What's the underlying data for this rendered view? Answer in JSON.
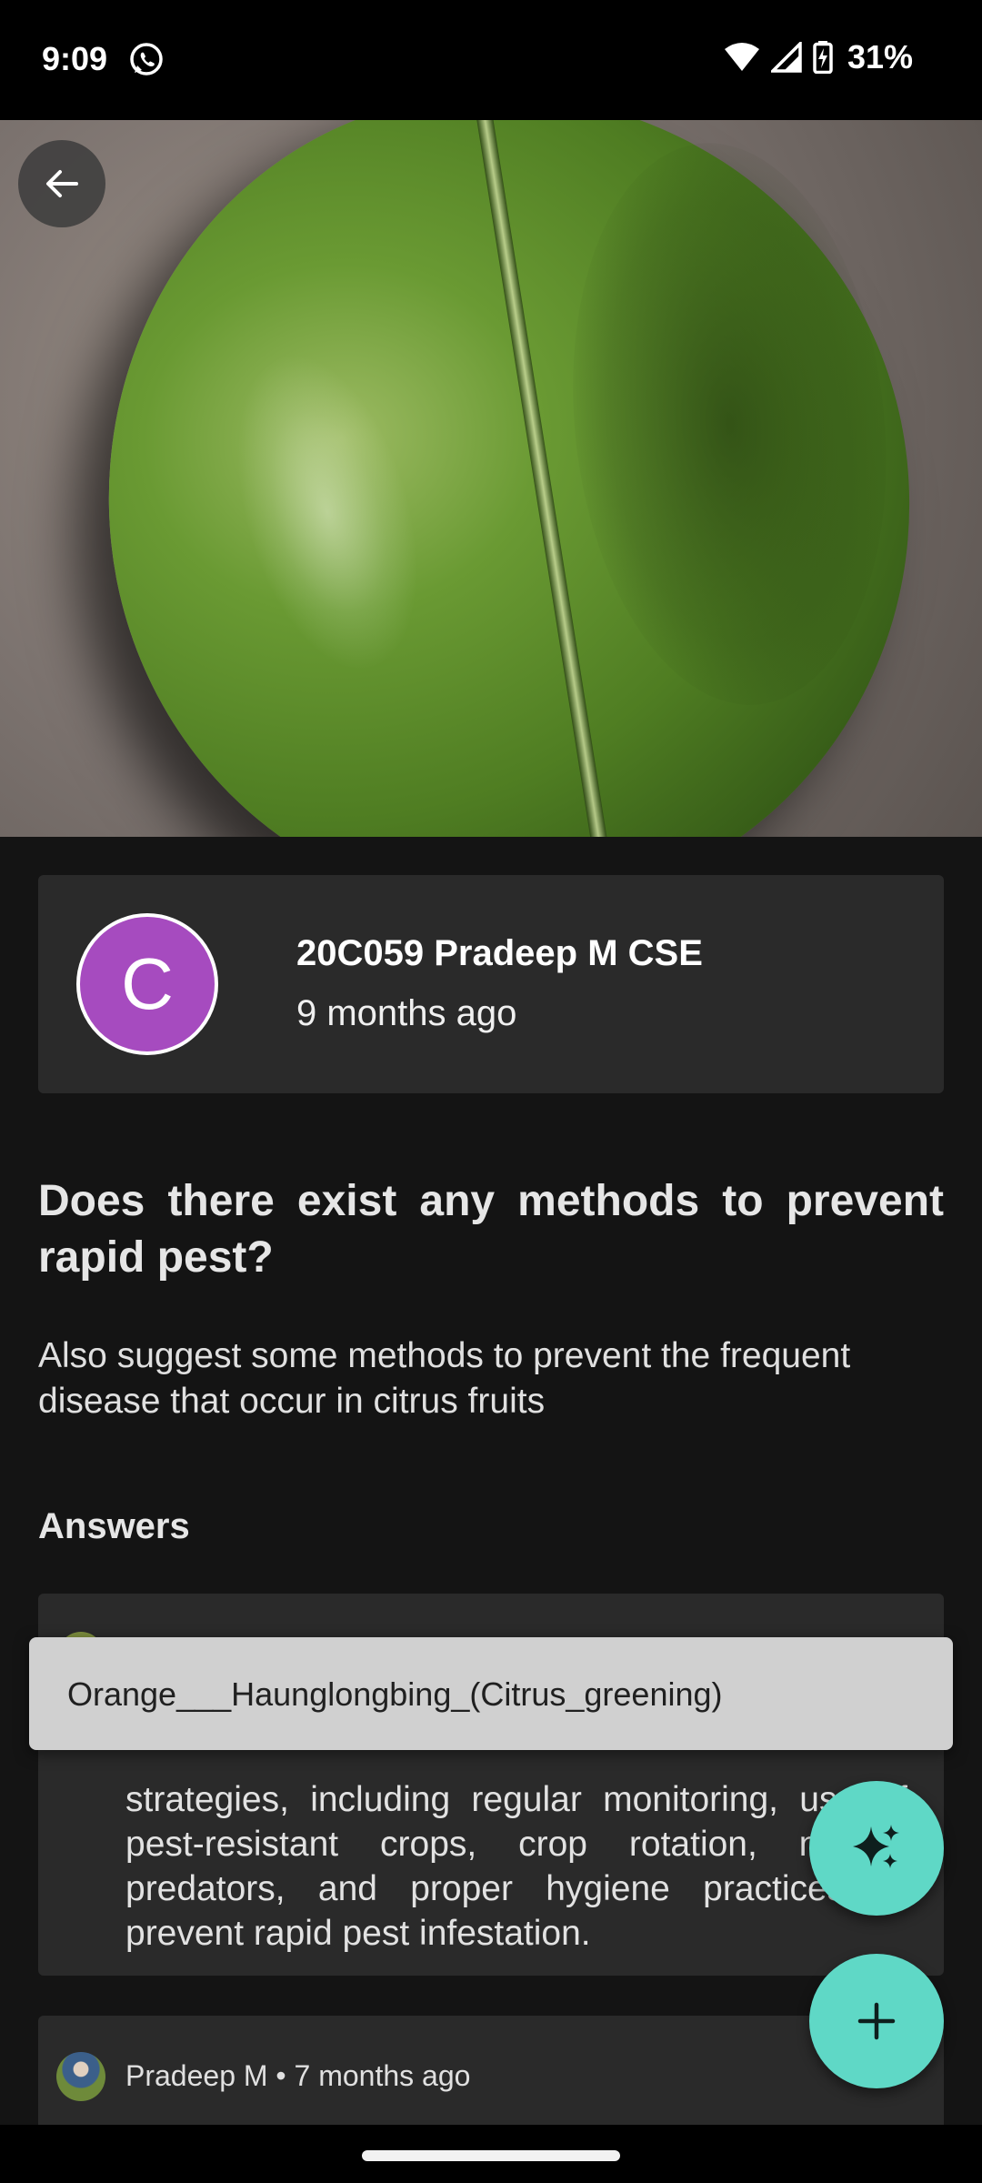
{
  "status_bar": {
    "time": "9:09",
    "battery": "31%"
  },
  "question": {
    "author_initial": "C",
    "author_name": "20C059 Pradeep M CSE",
    "posted": "9 months ago",
    "title": "Does there exist any methods to prevent rapid pest?",
    "body": "Also suggest some  methods to prevent the frequent disease that occur in citrus fruits"
  },
  "answers": {
    "heading": "Answers",
    "items": [
      {
        "text": "strategies, including regular monitoring, use of pest-resistant crops, crop rotation, natural predators, and proper hygiene practices to prevent rapid pest infestation."
      },
      {
        "author": "Pradeep M",
        "separator": "•",
        "posted": "7 months ago"
      }
    ]
  },
  "toast": {
    "text": "Orange___Haunglongbing_(Citrus_greening)"
  },
  "colors": {
    "accent": "#5fd8c6",
    "avatar_bg": "#a64bbf",
    "card_bg": "#2a2a2a",
    "page_bg": "#141414"
  },
  "icons": {
    "back": "arrow-left-icon",
    "ai": "sparkle-icon",
    "add": "plus-icon"
  }
}
